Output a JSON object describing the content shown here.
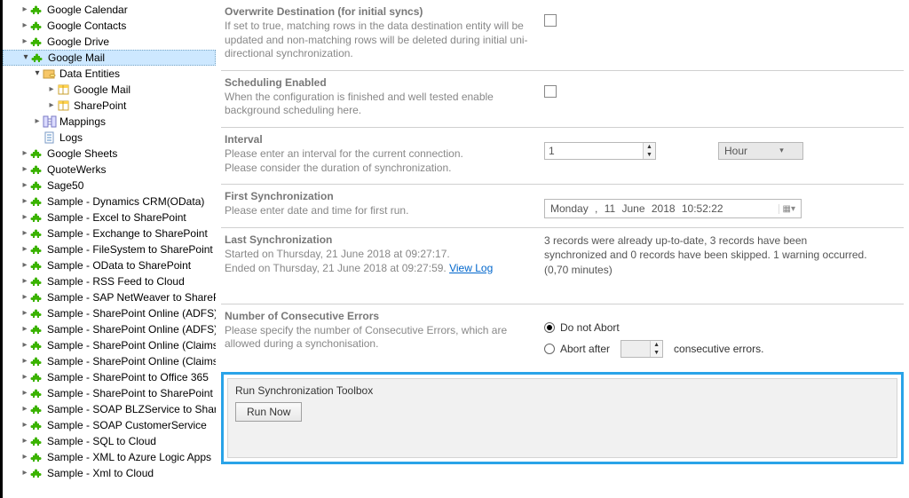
{
  "tree": {
    "google_calendar": "Google Calendar",
    "google_contacts": "Google Contacts",
    "google_drive": "Google Drive",
    "google_mail": "Google Mail",
    "data_entities": "Data Entities",
    "de_google_mail": "Google Mail",
    "de_sharepoint": "SharePoint",
    "mappings": "Mappings",
    "logs": "Logs",
    "google_sheets": "Google Sheets",
    "quotewerks": "QuoteWerks",
    "sage50": "Sage50",
    "s1": "Sample - Dynamics CRM(OData)",
    "s2": "Sample - Excel to SharePoint",
    "s3": "Sample - Exchange to SharePoint",
    "s4": "Sample - FileSystem to SharePoint",
    "s5": "Sample - OData to SharePoint",
    "s6": "Sample - RSS Feed to Cloud",
    "s7": "Sample - SAP NetWeaver to SharePoint",
    "s8": "Sample - SharePoint Online (ADFS)",
    "s9": "Sample - SharePoint Online (ADFS)",
    "s10": "Sample - SharePoint Online (Claims)",
    "s11": "Sample - SharePoint Online (Claims)",
    "s12": "Sample - SharePoint to Office 365",
    "s13": "Sample - SharePoint to SharePoint",
    "s14": "Sample - SOAP BLZService to SharePoint",
    "s15": "Sample - SOAP CustomerService",
    "s16": "Sample - SQL to Cloud",
    "s17": "Sample - XML to Azure Logic Apps",
    "s18": "Sample - Xml to Cloud"
  },
  "overwrite": {
    "title": "Overwrite Destination (for initial syncs)",
    "desc": "If set to true, matching rows in the data destination entity will be updated and non-matching rows will be deleted during initial uni-directional synchronization."
  },
  "sched": {
    "title": "Scheduling Enabled",
    "desc": "When the configuration is finished and well tested enable background scheduling here."
  },
  "interval": {
    "title": "Interval",
    "desc1": "Please enter an interval for the current connection.",
    "desc2": "Please consider the duration of synchronization.",
    "value": "1",
    "unit": "Hour"
  },
  "first": {
    "title": "First Synchronization",
    "desc": "Please enter date and time for first run.",
    "value": "Monday , 11 June 2018 10:52:22"
  },
  "last": {
    "title": "Last Synchronization",
    "line1": "Started  on Thursday, 21 June 2018 at 09:27:17.",
    "line2_a": "Ended on Thursday, 21 June 2018 at 09:27:59. ",
    "view_log": "View Log",
    "status": "3 records were already up-to-date, 3 records have been synchronized and 0 records have been skipped. 1 warning occurred. (0,70 minutes)"
  },
  "errors": {
    "title": "Number of Consecutive Errors",
    "desc": "Please specify the number of Consecutive Errors, which are allowed during a synchonisation.",
    "opt1": "Do not Abort",
    "opt2a": "Abort after",
    "opt2b": "consecutive errors."
  },
  "toolbox": {
    "title": "Run Synchronization Toolbox",
    "run": "Run Now"
  }
}
